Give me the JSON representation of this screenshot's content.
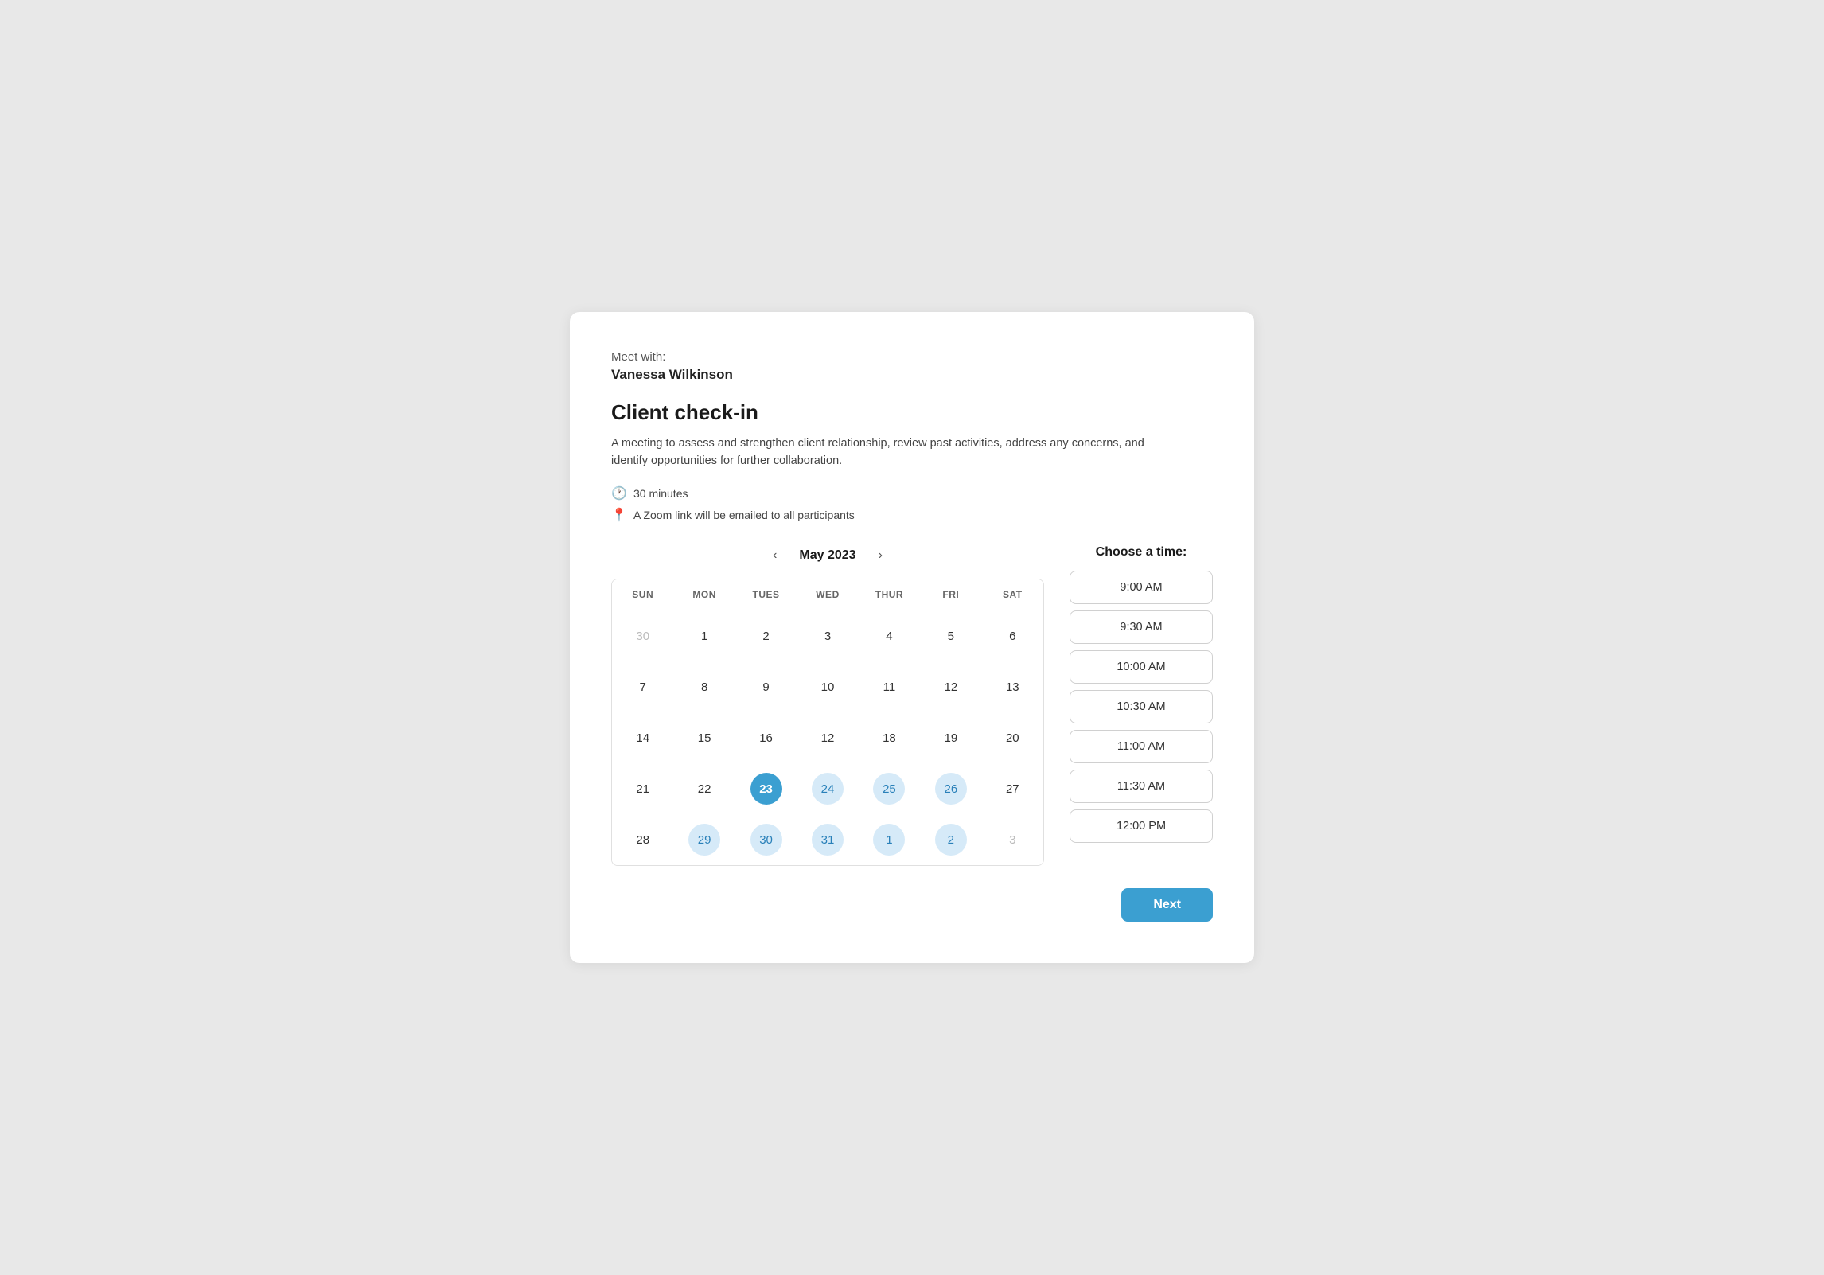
{
  "header": {
    "meet_with_label": "Meet with:",
    "name": "Vanessa Wilkinson"
  },
  "event": {
    "title": "Client check-in",
    "description": "A meeting to assess and strengthen client relationship, review past activities, address any concerns, and identify opportunities for further collaboration.",
    "duration": "30 minutes",
    "location": "A Zoom link will be emailed to all participants"
  },
  "calendar": {
    "month_label": "May 2023",
    "day_headers": [
      "SUN",
      "MON",
      "TUES",
      "WED",
      "THUR",
      "FRI",
      "SAT"
    ],
    "weeks": [
      [
        {
          "day": "30",
          "type": "other-month"
        },
        {
          "day": "1",
          "type": "normal"
        },
        {
          "day": "2",
          "type": "normal"
        },
        {
          "day": "3",
          "type": "normal"
        },
        {
          "day": "4",
          "type": "normal"
        },
        {
          "day": "5",
          "type": "normal"
        },
        {
          "day": "6",
          "type": "normal"
        }
      ],
      [
        {
          "day": "7",
          "type": "normal"
        },
        {
          "day": "8",
          "type": "normal"
        },
        {
          "day": "9",
          "type": "normal"
        },
        {
          "day": "10",
          "type": "normal"
        },
        {
          "day": "11",
          "type": "normal"
        },
        {
          "day": "12",
          "type": "normal"
        },
        {
          "day": "13",
          "type": "normal"
        }
      ],
      [
        {
          "day": "14",
          "type": "normal"
        },
        {
          "day": "15",
          "type": "normal"
        },
        {
          "day": "16",
          "type": "normal"
        },
        {
          "day": "12",
          "type": "normal"
        },
        {
          "day": "18",
          "type": "normal"
        },
        {
          "day": "19",
          "type": "normal"
        },
        {
          "day": "20",
          "type": "normal"
        }
      ],
      [
        {
          "day": "21",
          "type": "normal"
        },
        {
          "day": "22",
          "type": "normal"
        },
        {
          "day": "23",
          "type": "selected"
        },
        {
          "day": "24",
          "type": "highlighted"
        },
        {
          "day": "25",
          "type": "highlighted"
        },
        {
          "day": "26",
          "type": "highlighted"
        },
        {
          "day": "27",
          "type": "normal"
        }
      ],
      [
        {
          "day": "28",
          "type": "normal"
        },
        {
          "day": "29",
          "type": "highlighted"
        },
        {
          "day": "30",
          "type": "highlighted"
        },
        {
          "day": "31",
          "type": "highlighted"
        },
        {
          "day": "1",
          "type": "highlighted other-month"
        },
        {
          "day": "2",
          "type": "highlighted other-month"
        },
        {
          "day": "3",
          "type": "other-month"
        }
      ]
    ]
  },
  "time_slots": {
    "title": "Choose a time:",
    "slots": [
      "9:00 AM",
      "9:30 AM",
      "10:00 AM",
      "10:30 AM",
      "11:00 AM",
      "11:30 AM",
      "12:00 PM"
    ]
  },
  "footer": {
    "next_label": "Next"
  }
}
